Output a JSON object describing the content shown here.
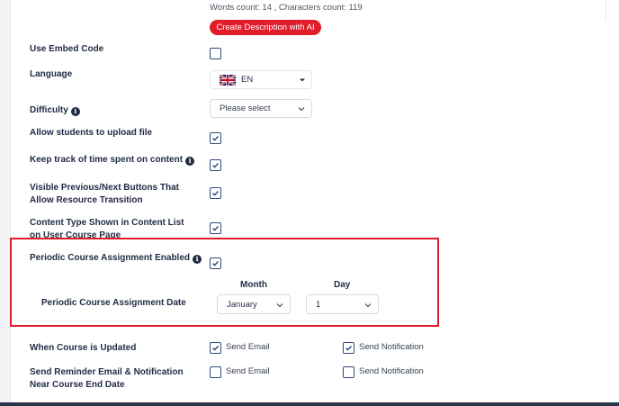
{
  "description": {
    "counter": "Words count: 14 , Characters count: 119",
    "ai_button": "Create Description with AI"
  },
  "embed": {
    "label": "Use Embed Code",
    "checked": false
  },
  "language": {
    "label": "Language",
    "value": "EN",
    "flag_icon": "uk-flag-icon"
  },
  "difficulty": {
    "label": "Difficulty",
    "placeholder": "Please select"
  },
  "upload": {
    "label": "Allow students to upload file",
    "checked": true
  },
  "track_time": {
    "label": "Keep track of time spent on content",
    "checked": true
  },
  "prev_next": {
    "label": "Visible Previous/Next Buttons That Allow Resource Transition",
    "checked": true
  },
  "content_type": {
    "label": "Content Type Shown in Content List on User Course Page",
    "checked": true
  },
  "periodic": {
    "enabled_label": "Periodic Course Assignment Enabled",
    "enabled_checked": true,
    "date_label": "Periodic Course Assignment Date",
    "month_header": "Month",
    "day_header": "Day",
    "month_value": "January",
    "day_value": "1"
  },
  "course_updated": {
    "label": "When Course is Updated",
    "send_email": "Send Email",
    "send_email_checked": true,
    "send_notification": "Send Notification",
    "send_notification_checked": true
  },
  "reminder": {
    "label": "Send Reminder Email & Notification Near Course End Date",
    "send_email": "Send Email",
    "send_email_checked": false,
    "send_notification": "Send Notification",
    "send_notification_checked": false
  },
  "colors": {
    "accent_red": "#e11d2a",
    "checkbox_border": "#2f4a7a",
    "text_dark": "#1f2a44"
  }
}
